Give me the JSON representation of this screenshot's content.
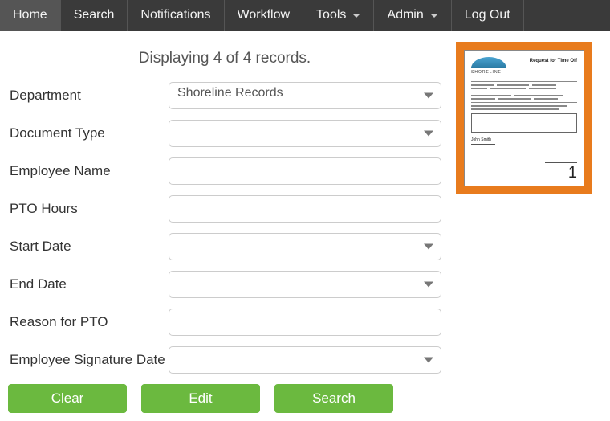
{
  "nav": {
    "home": "Home",
    "search": "Search",
    "notifications": "Notifications",
    "workflow": "Workflow",
    "tools": "Tools",
    "admin": "Admin",
    "logout": "Log Out"
  },
  "status_text": "Displaying 4 of 4 records.",
  "fields": {
    "department": {
      "label": "Department",
      "value": "Shoreline Records"
    },
    "document_type": {
      "label": "Document Type",
      "value": ""
    },
    "employee_name": {
      "label": "Employee Name",
      "value": ""
    },
    "pto_hours": {
      "label": "PTO Hours",
      "value": ""
    },
    "start_date": {
      "label": "Start Date",
      "value": ""
    },
    "end_date": {
      "label": "End Date",
      "value": ""
    },
    "reason": {
      "label": "Reason for PTO",
      "value": ""
    },
    "sig_date": {
      "label": "Employee Signature Date",
      "value": ""
    }
  },
  "buttons": {
    "clear": "Clear",
    "edit": "Edit",
    "search": "Search"
  },
  "thumbnail": {
    "brand": "SHORELINE",
    "doc_title": "Request for Time Off",
    "page_number": "1"
  }
}
